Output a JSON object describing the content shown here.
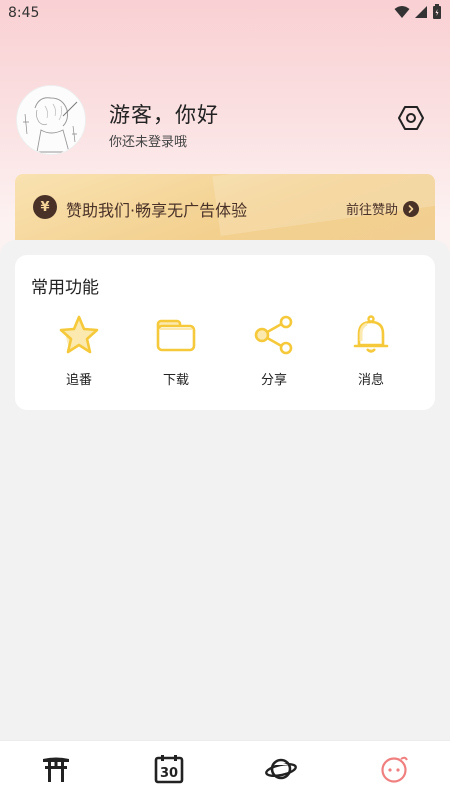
{
  "status_bar": {
    "time": "8:45",
    "icons": [
      "wifi-icon",
      "signal-icon",
      "battery-icon"
    ]
  },
  "profile": {
    "greeting": "游客，你好",
    "sub_greeting": "你还未登录哦",
    "avatar_icon": "sketch-avatar",
    "settings_icon": "settings-hexagon-icon"
  },
  "sponsor_banner": {
    "coin_symbol": "¥",
    "text": "赞助我们·畅享无广告体验",
    "link_label": "前往赞助"
  },
  "common_functions": {
    "title": "常用功能",
    "items": [
      {
        "label": "追番",
        "icon": "star-icon"
      },
      {
        "label": "下载",
        "icon": "folder-icon"
      },
      {
        "label": "分享",
        "icon": "share-icon"
      },
      {
        "label": "消息",
        "icon": "bell-icon"
      }
    ]
  },
  "bottom_nav": {
    "items": [
      {
        "icon": "torii-gate-icon",
        "active": false
      },
      {
        "icon": "calendar-icon",
        "active": false,
        "text": "30"
      },
      {
        "icon": "planet-icon",
        "active": false
      },
      {
        "icon": "mascot-face-icon",
        "active": true
      }
    ]
  },
  "colors": {
    "accent_yellow": "#f5c93a",
    "accent_pink": "#f08080",
    "banner_text": "#4a3128"
  }
}
